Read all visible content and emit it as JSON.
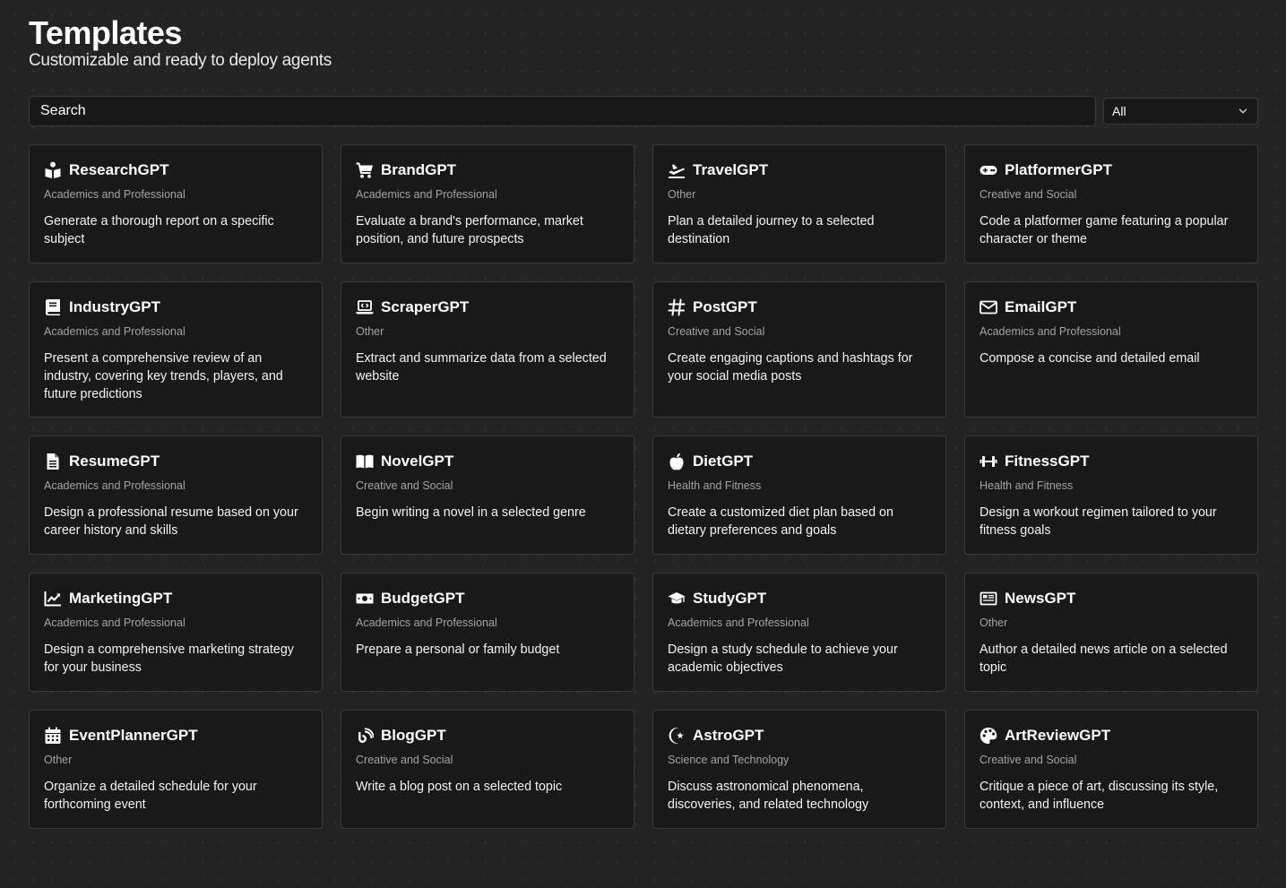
{
  "header": {
    "title": "Templates",
    "subtitle": "Customizable and ready to deploy agents"
  },
  "search": {
    "placeholder": "Search",
    "value": ""
  },
  "filter": {
    "selected": "All"
  },
  "cards": [
    {
      "title": "ResearchGPT",
      "category": "Academics and Professional",
      "description": "Generate a thorough report on a specific subject",
      "icon": "book-reader-icon"
    },
    {
      "title": "BrandGPT",
      "category": "Academics and Professional",
      "description": "Evaluate a brand's performance, market position, and future prospects",
      "icon": "shopping-cart-icon"
    },
    {
      "title": "TravelGPT",
      "category": "Other",
      "description": "Plan a detailed journey to a selected destination",
      "icon": "plane-departure-icon"
    },
    {
      "title": "PlatformerGPT",
      "category": "Creative and Social",
      "description": "Code a platformer game featuring a popular character or theme",
      "icon": "gamepad-icon"
    },
    {
      "title": "IndustryGPT",
      "category": "Academics and Professional",
      "description": "Present a comprehensive review of an industry, covering key trends, players, and future predictions",
      "icon": "book-icon"
    },
    {
      "title": "ScraperGPT",
      "category": "Other",
      "description": "Extract and summarize data from a selected website",
      "icon": "laptop-code-icon"
    },
    {
      "title": "PostGPT",
      "category": "Creative and Social",
      "description": "Create engaging captions and hashtags for your social media posts",
      "icon": "hashtag-icon"
    },
    {
      "title": "EmailGPT",
      "category": "Academics and Professional",
      "description": "Compose a concise and detailed email",
      "icon": "envelope-icon"
    },
    {
      "title": "ResumeGPT",
      "category": "Academics and Professional",
      "description": "Design a professional resume based on your career history and skills",
      "icon": "file-icon"
    },
    {
      "title": "NovelGPT",
      "category": "Creative and Social",
      "description": "Begin writing a novel in a selected genre",
      "icon": "book-open-icon"
    },
    {
      "title": "DietGPT",
      "category": "Health and Fitness",
      "description": "Create a customized diet plan based on dietary preferences and goals",
      "icon": "apple-icon"
    },
    {
      "title": "FitnessGPT",
      "category": "Health and Fitness",
      "description": "Design a workout regimen tailored to your fitness goals",
      "icon": "dumbbell-icon"
    },
    {
      "title": "MarketingGPT",
      "category": "Academics and Professional",
      "description": "Design a comprehensive marketing strategy for your business",
      "icon": "chart-line-icon"
    },
    {
      "title": "BudgetGPT",
      "category": "Academics and Professional",
      "description": "Prepare a personal or family budget",
      "icon": "money-bill-icon"
    },
    {
      "title": "StudyGPT",
      "category": "Academics and Professional",
      "description": "Design a study schedule to achieve your academic objectives",
      "icon": "graduation-cap-icon"
    },
    {
      "title": "NewsGPT",
      "category": "Other",
      "description": "Author a detailed news article on a selected topic",
      "icon": "newspaper-icon"
    },
    {
      "title": "EventPlannerGPT",
      "category": "Other",
      "description": "Organize a detailed schedule for your forthcoming event",
      "icon": "calendar-icon"
    },
    {
      "title": "BlogGPT",
      "category": "Creative and Social",
      "description": "Write a blog post on a selected topic",
      "icon": "blog-icon"
    },
    {
      "title": "AstroGPT",
      "category": "Science and Technology",
      "description": "Discuss astronomical phenomena, discoveries, and related technology",
      "icon": "star-and-crescent-icon"
    },
    {
      "title": "ArtReviewGPT",
      "category": "Creative and Social",
      "description": "Critique a piece of art, discussing its style, context, and influence",
      "icon": "palette-icon"
    }
  ]
}
